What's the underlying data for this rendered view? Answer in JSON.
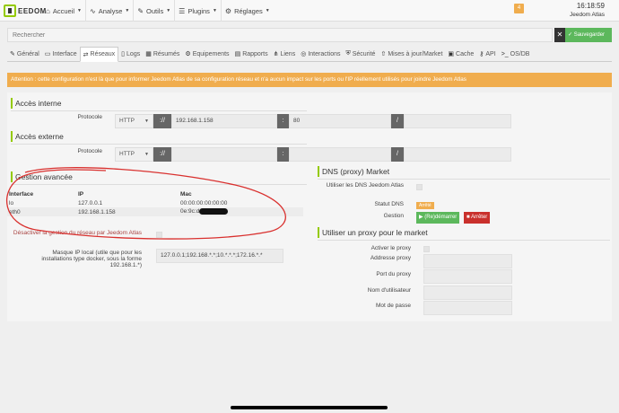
{
  "navbar": {
    "logo_text": "EEDOM",
    "menu": [
      {
        "icon": "home-icon",
        "glyph": "⌂",
        "label": "Accueil"
      },
      {
        "icon": "stethoscope-icon",
        "glyph": "∿",
        "label": "Analyse"
      },
      {
        "icon": "wrench-icon",
        "glyph": "✎",
        "label": "Outils"
      },
      {
        "icon": "tasks-icon",
        "glyph": "☰",
        "label": "Plugins"
      },
      {
        "icon": "gear-icon",
        "glyph": "⚙",
        "label": "Réglages"
      }
    ],
    "message_count": "4",
    "time": "16:18:59",
    "hostname": "Jeedom Atlas"
  },
  "search": {
    "placeholder": "Rechercher",
    "clear_glyph": "✕",
    "save_label": "Sauvegarder",
    "save_glyph": "✓"
  },
  "tabs": [
    {
      "icon": "wrench-icon",
      "glyph": "✎",
      "label": "Général"
    },
    {
      "icon": "interface-icon",
      "glyph": "▭",
      "label": "Interface"
    },
    {
      "icon": "network-icon",
      "glyph": "⇄",
      "label": "Réseaux"
    },
    {
      "icon": "file-icon",
      "glyph": "▯",
      "label": "Logs"
    },
    {
      "icon": "table-icon",
      "glyph": "▦",
      "label": "Résumés"
    },
    {
      "icon": "equipment-icon",
      "glyph": "⚙",
      "label": "Equipements"
    },
    {
      "icon": "report-icon",
      "glyph": "▤",
      "label": "Rapports"
    },
    {
      "icon": "links-icon",
      "glyph": "⋔",
      "label": "Liens"
    },
    {
      "icon": "interaction-icon",
      "glyph": "◎",
      "label": "Interactions"
    },
    {
      "icon": "shield-icon",
      "glyph": "⛨",
      "label": "Sécurité"
    },
    {
      "icon": "update-icon",
      "glyph": "⇧",
      "label": "Mises à jour/Market"
    },
    {
      "icon": "cache-icon",
      "glyph": "▣",
      "label": "Cache"
    },
    {
      "icon": "api-icon",
      "glyph": "⚷",
      "label": "API"
    },
    {
      "icon": "os-icon",
      "glyph": ">_",
      "label": "OS/DB"
    }
  ],
  "active_tab": 2,
  "alert": "Attention : cette configuration n'est là que pour informer Jeedom Atlas de sa configuration réseau et n'a aucun impact sur les ports ou l'IP réellement utilisés pour joindre Jeedom Atlas",
  "internal": {
    "title": "Accès interne",
    "protocol_label": "Protocole",
    "protocol": "HTTP",
    "sep": "://",
    "host": "192.168.1.158",
    "colon": ":",
    "port": "80",
    "slash": "/",
    "path": ""
  },
  "external": {
    "title": "Accès externe",
    "protocol_label": "Protocole",
    "protocol": "HTTP",
    "sep": "://",
    "host": "",
    "colon": ":",
    "port": "",
    "slash": "/",
    "path": ""
  },
  "advanced": {
    "title": "Gestion avancée",
    "headers": [
      "Interface",
      "IP",
      "Mac"
    ],
    "rows": [
      {
        "interface": "lo",
        "ip": "127.0.0.1",
        "mac": "00:00:00:00:00:00"
      },
      {
        "interface": "eth0",
        "ip": "192.168.1.158",
        "mac": "0e:9c:d"
      }
    ],
    "disable_label": "Désactiver la gestion du réseau par Jeedom Atlas",
    "mask_label": "Masque IP local (utile que pour les installations type docker, sous la forme 192.168.1.*)",
    "mask_value": "127.0.0.1;192.168.*.*;10.*.*.*;172.16.*.*"
  },
  "dns": {
    "title": "DNS (proxy) Market",
    "use_dns_label": "Utiliser les DNS Jeedom Atlas",
    "status_label": "Statut DNS",
    "status_value": "Arrêté",
    "manage_label": "Gestion",
    "restart_label": "(Re)démarrer",
    "restart_glyph": "▶",
    "stop_label": "Arrêter",
    "stop_glyph": "■"
  },
  "proxy": {
    "title": "Utiliser un proxy pour le market",
    "enable_label": "Activer le proxy",
    "address_label": "Addresse proxy",
    "port_label": "Port du proxy",
    "user_label": "Nom d'utilisateur",
    "password_label": "Mot de passe"
  },
  "colors": {
    "accent": "#94ca02",
    "warning": "#f0ad4e",
    "success": "#5cb85c",
    "danger": "#c9302c",
    "annotation": "#d9302e"
  }
}
